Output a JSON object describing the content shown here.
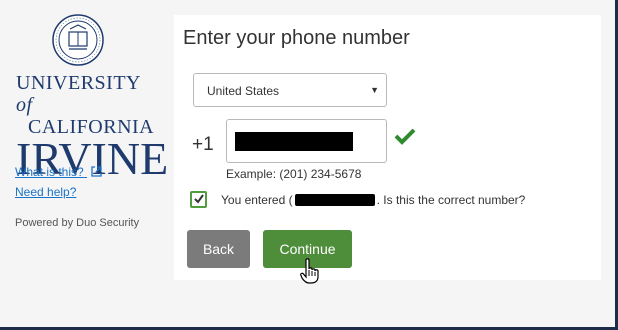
{
  "sidebar": {
    "logo": {
      "wordmark_line1_a": "UNIVERSITY",
      "wordmark_line1_b": "of",
      "wordmark_line2": "CALIFORNIA",
      "wordmark_line3": "IRVINE"
    },
    "what_is_this_label": "What is this?",
    "need_help_label": "Need help?",
    "powered_by": "Powered by Duo Security"
  },
  "main": {
    "title": "Enter your phone number",
    "country_select": {
      "selected": "United States"
    },
    "dial_code": "+1",
    "example": "Example: (201) 234-5678",
    "confirm": {
      "text_before": "You entered (",
      "text_after": ". Is this the correct number?"
    },
    "back_label": "Back",
    "continue_label": "Continue"
  },
  "colors": {
    "continue": "#4e8d3a",
    "back": "#7b7b7b",
    "link": "#1a73c8",
    "brand_blue": "#1f3b6e",
    "check": "#2e8b2e"
  }
}
